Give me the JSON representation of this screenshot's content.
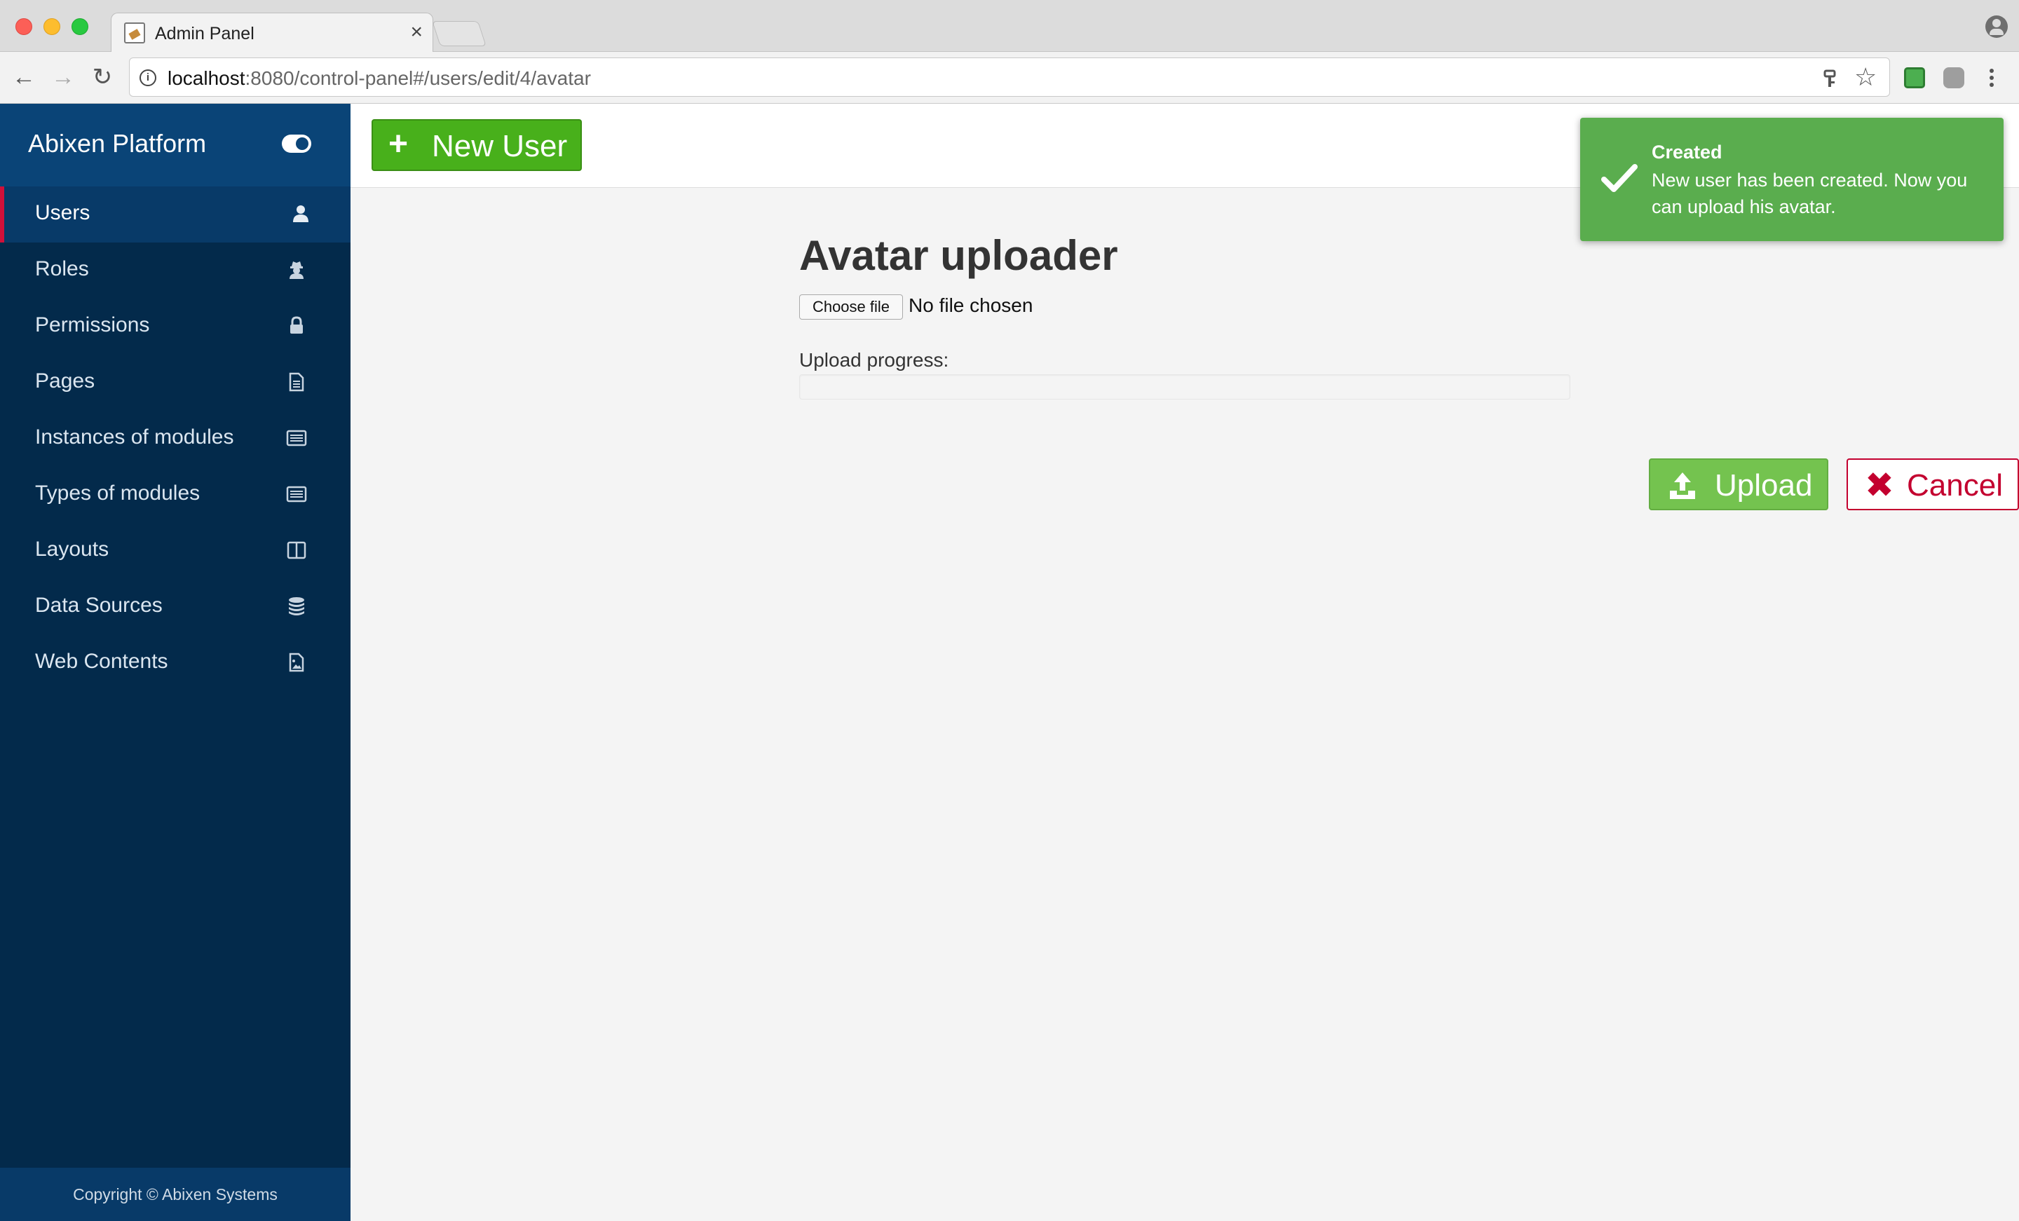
{
  "browser": {
    "tab_title": "Admin Panel",
    "tab_close": "×",
    "url_host": "localhost",
    "url_rest": ":8080/control-panel#/users/edit/4/avatar",
    "back": "←",
    "forward": "→",
    "reload": "↻"
  },
  "sidebar": {
    "brand": "Abixen Platform",
    "items": [
      {
        "label": "Users",
        "icon": "user-icon"
      },
      {
        "label": "Roles",
        "icon": "user-secret-icon"
      },
      {
        "label": "Permissions",
        "icon": "lock-icon"
      },
      {
        "label": "Pages",
        "icon": "file-text-icon"
      },
      {
        "label": "Instances of modules",
        "icon": "list-alt-icon"
      },
      {
        "label": "Types of modules",
        "icon": "list-alt-icon"
      },
      {
        "label": "Layouts",
        "icon": "columns-icon"
      },
      {
        "label": "Data Sources",
        "icon": "database-icon"
      },
      {
        "label": "Web Contents",
        "icon": "file-image-icon"
      }
    ],
    "active_item": "Users",
    "footer": "Copyright © Abixen Systems"
  },
  "topbar": {
    "new_user_label": "New User",
    "new_user_icon": "+"
  },
  "main": {
    "title": "Avatar uploader",
    "choose_file_label": "Choose file",
    "file_status": "No file chosen",
    "progress_label": "Upload progress:",
    "progress_value": 0,
    "upload_label": "Upload",
    "cancel_label": "Cancel",
    "cancel_icon": "✖"
  },
  "toast": {
    "title": "Created",
    "message": "New user has been created. Now you can upload his avatar."
  },
  "colors": {
    "sidebar_bg": "#032a4b",
    "brand_bg": "#0a4477",
    "active_marker": "#d0103a",
    "success_green": "#48b01b",
    "toast_green": "#5aad4e",
    "cancel_red": "#c3002f"
  }
}
